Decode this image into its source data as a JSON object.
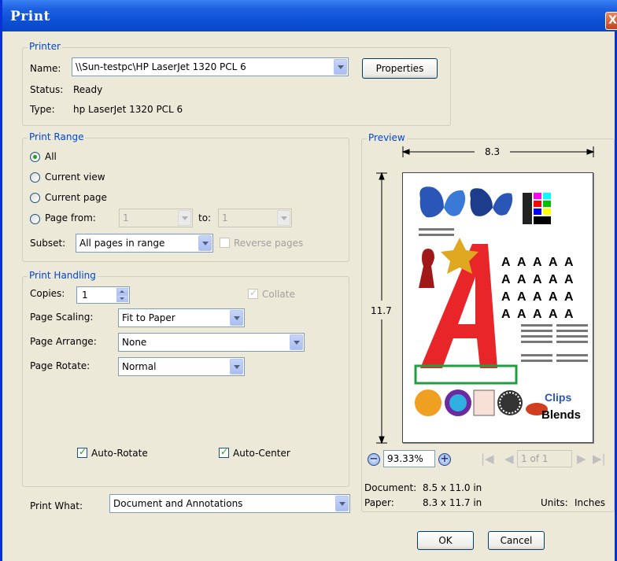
{
  "window": {
    "title": "Print",
    "close_glyph": "X"
  },
  "printer": {
    "group_label": "Printer",
    "name_label": "Name:",
    "name_value": "\\\\Sun-testpc\\HP LaserJet 1320 PCL 6",
    "properties_label": "Properties",
    "status_label": "Status:",
    "status_value": "Ready",
    "type_label": "Type:",
    "type_value": "hp LaserJet 1320 PCL 6"
  },
  "print_range": {
    "group_label": "Print Range",
    "all_label": "All",
    "current_view_label": "Current view",
    "current_page_label": "Current page",
    "page_from_label": "Page from:",
    "from_value": "1",
    "to_label": "to:",
    "to_value": "1",
    "subset_label": "Subset:",
    "subset_value": "All pages in range",
    "reverse_label": "Reverse pages",
    "selected": "all"
  },
  "print_handling": {
    "group_label": "Print Handling",
    "copies_label": "Copies:",
    "copies_value": "1",
    "collate_label": "Collate",
    "collate_checked": true,
    "page_scaling_label": "Page Scaling:",
    "page_scaling_value": "Fit to Paper",
    "page_arrange_label": "Page Arrange:",
    "page_arrange_value": "None",
    "page_rotate_label": "Page Rotate:",
    "page_rotate_value": "Normal",
    "auto_rotate_label": "Auto-Rotate",
    "auto_rotate_checked": true,
    "auto_center_label": "Auto-Center",
    "auto_center_checked": true
  },
  "print_what": {
    "label": "Print What:",
    "value": "Document and Annotations"
  },
  "preview": {
    "group_label": "Preview",
    "width_dim": "8.3",
    "height_dim": "11.7",
    "zoom_value": "93.33%",
    "page_indicator": "1 of 1",
    "document_label": "Document:",
    "document_value": "8.5 x 11.0 in",
    "paper_label": "Paper:",
    "paper_value": "8.3 x 11.7 in",
    "units_label": "Units:",
    "units_value": "Inches",
    "zoom_out_glyph": "−",
    "zoom_in_glyph": "+",
    "first_glyph": "|◀",
    "prev_glyph": "◀",
    "next_glyph": "▶",
    "last_glyph": "▶|"
  },
  "buttons": {
    "ok_label": "OK",
    "cancel_label": "Cancel"
  },
  "colors": {
    "title_bar": "#0a4fd4",
    "group_title": "#0046d5",
    "dialog_bg": "#ece9d8"
  }
}
